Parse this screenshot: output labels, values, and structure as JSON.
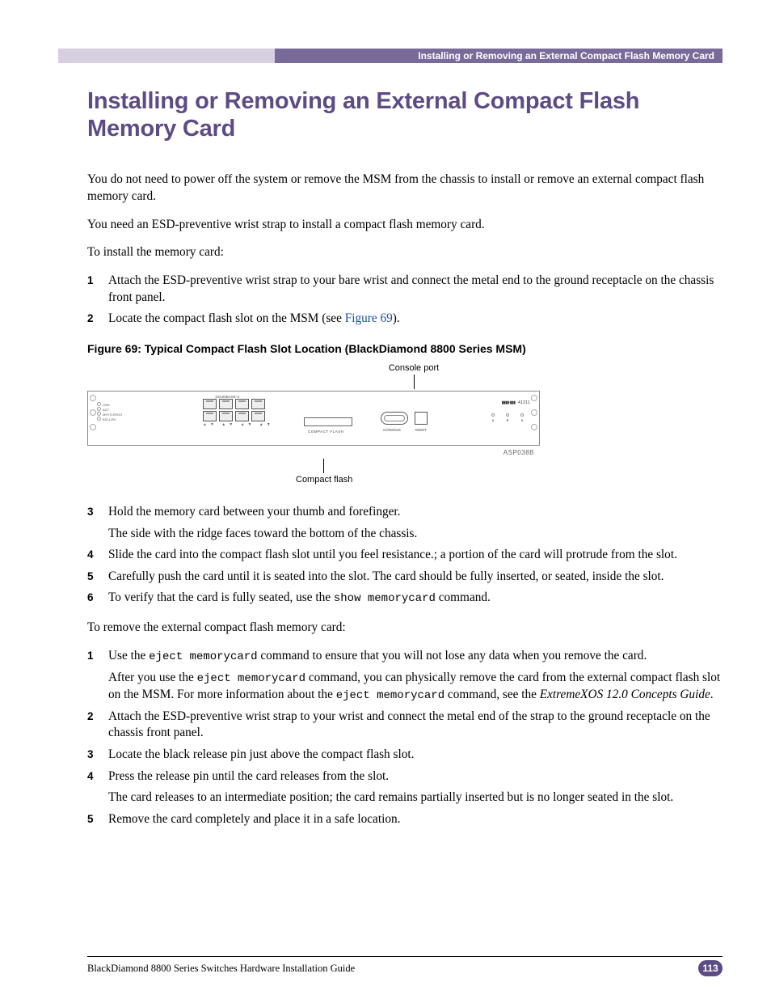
{
  "header": {
    "breadcrumb": "Installing or Removing an External Compact Flash Memory Card"
  },
  "title": "Installing or Removing an External Compact Flash Memory Card",
  "intro": {
    "p1": "You do not need to power off the system or remove the MSM from the chassis to install or remove an external compact flash memory card.",
    "p2": "You need an ESD-preventive wrist strap to install a compact flash memory card.",
    "p3": "To install the memory card:"
  },
  "install_steps": [
    {
      "num": "1",
      "text": "Attach the ESD-preventive wrist strap to your bare wrist and connect the metal end to the ground receptacle on the chassis front panel."
    },
    {
      "num": "2",
      "pre": "Locate the compact flash slot on the MSM (see ",
      "link": "Figure 69",
      "post": ")."
    }
  ],
  "figure": {
    "caption": "Figure 69:  Typical Compact Flash Slot Location (BlackDiamond 8800 Series MSM)",
    "callout_top": "Console port",
    "callout_bottom": "Compact flash",
    "asp": "ASP038B",
    "model_left": "10/100BASE-X",
    "model_right": "41211",
    "cf_label": "COMPACT FLASH",
    "console_label": "CONSOLE",
    "mgmt_label": "MGMT"
  },
  "after_fig_steps": [
    {
      "num": "3",
      "text": "Hold the memory card between your thumb and forefinger.",
      "sub": "The side with the ridge faces toward the bottom of the chassis."
    },
    {
      "num": "4",
      "text": "Slide the card into the compact flash slot until you feel resistance.; a portion of the card will protrude from the slot."
    },
    {
      "num": "5",
      "text": "Carefully push the card until it is seated into the slot. The card should be fully inserted, or seated, inside the slot."
    },
    {
      "num": "6",
      "pre": "To verify that the card is fully seated, use the ",
      "cmd": "show memorycard",
      "post": " command."
    }
  ],
  "remove_intro": "To remove the external compact flash memory card:",
  "remove_steps": [
    {
      "num": "1",
      "pre": "Use the ",
      "cmd": "eject memorycard",
      "post": " command to ensure that you will not lose any data when you remove the card.",
      "sub_pre": "After you use the ",
      "sub_cmd1": "eject memorycard",
      "sub_mid": " command, you can physically remove the card from the external compact flash slot on the MSM. For more information about the ",
      "sub_cmd2": "eject memorycard",
      "sub_mid2": " command, see the ",
      "sub_book": "ExtremeXOS 12.0 Concepts Guide",
      "sub_end": "."
    },
    {
      "num": "2",
      "text": "Attach the ESD-preventive wrist strap to your wrist and connect the metal end of the strap to the ground receptacle on the chassis front panel."
    },
    {
      "num": "3",
      "text": "Locate the black release pin just above the compact flash slot."
    },
    {
      "num": "4",
      "text": "Press the release pin until the card releases from the slot.",
      "sub": "The card releases to an intermediate position; the card remains partially inserted but is no longer seated in the slot."
    },
    {
      "num": "5",
      "text": "Remove the card completely and place it in a safe location."
    }
  ],
  "footer": {
    "title": "BlackDiamond 8800 Series Switches Hardware Installation Guide",
    "page": "113"
  }
}
